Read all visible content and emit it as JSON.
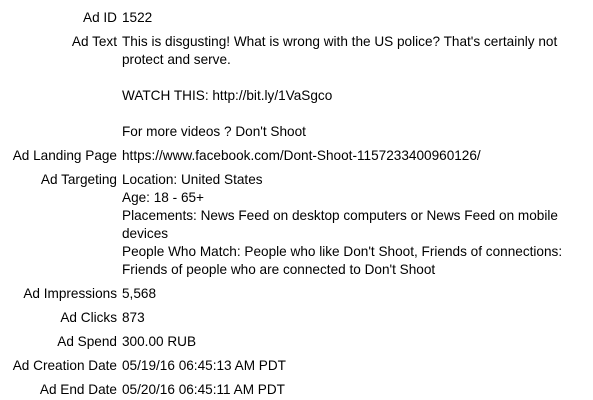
{
  "ad": {
    "fields": {
      "id": {
        "label": "Ad ID",
        "value": "1522"
      },
      "text": {
        "label": "Ad Text",
        "paragraphs": [
          "This is disgusting! What is wrong with the US police? That's certainly not protect and serve.",
          "WATCH THIS: http://bit.ly/1VaSgco",
          "For more videos ? Don't Shoot"
        ]
      },
      "landing_page": {
        "label": "Ad Landing Page",
        "value": "https://www.facebook.com/Dont-Shoot-1157233400960126/"
      },
      "targeting": {
        "label": "Ad Targeting",
        "lines": [
          "Location: United States",
          "Age: 18 - 65+",
          "Placements: News Feed on desktop computers or News Feed on mobile devices",
          "People Who Match: People who like Don't Shoot, Friends of connections: Friends of people who are connected to Don't Shoot"
        ]
      },
      "impressions": {
        "label": "Ad Impressions",
        "value": "5,568"
      },
      "clicks": {
        "label": "Ad Clicks",
        "value": "873"
      },
      "spend": {
        "label": "Ad Spend",
        "value": "300.00 RUB"
      },
      "creation_date": {
        "label": "Ad Creation Date",
        "value": "05/19/16 06:45:13 AM PDT"
      },
      "end_date": {
        "label": "Ad End Date",
        "value": "05/20/16 06:45:11 AM PDT"
      }
    }
  }
}
